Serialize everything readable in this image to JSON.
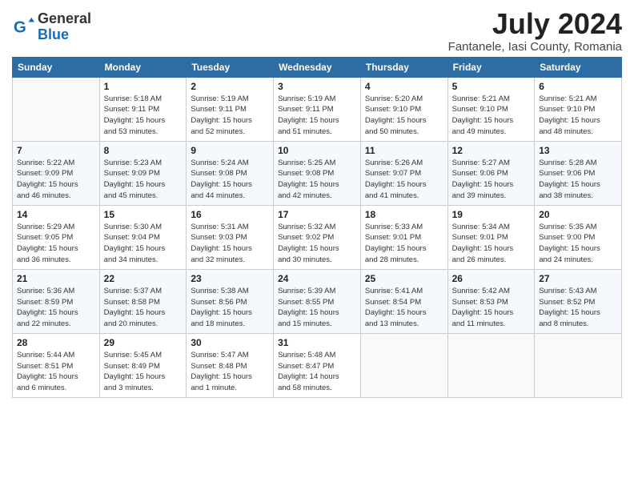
{
  "logo": {
    "general": "General",
    "blue": "Blue"
  },
  "title": "July 2024",
  "location": "Fantanele, Iasi County, Romania",
  "weekdays": [
    "Sunday",
    "Monday",
    "Tuesday",
    "Wednesday",
    "Thursday",
    "Friday",
    "Saturday"
  ],
  "weeks": [
    [
      {
        "day": "",
        "info": ""
      },
      {
        "day": "1",
        "info": "Sunrise: 5:18 AM\nSunset: 9:11 PM\nDaylight: 15 hours\nand 53 minutes."
      },
      {
        "day": "2",
        "info": "Sunrise: 5:19 AM\nSunset: 9:11 PM\nDaylight: 15 hours\nand 52 minutes."
      },
      {
        "day": "3",
        "info": "Sunrise: 5:19 AM\nSunset: 9:11 PM\nDaylight: 15 hours\nand 51 minutes."
      },
      {
        "day": "4",
        "info": "Sunrise: 5:20 AM\nSunset: 9:10 PM\nDaylight: 15 hours\nand 50 minutes."
      },
      {
        "day": "5",
        "info": "Sunrise: 5:21 AM\nSunset: 9:10 PM\nDaylight: 15 hours\nand 49 minutes."
      },
      {
        "day": "6",
        "info": "Sunrise: 5:21 AM\nSunset: 9:10 PM\nDaylight: 15 hours\nand 48 minutes."
      }
    ],
    [
      {
        "day": "7",
        "info": "Sunrise: 5:22 AM\nSunset: 9:09 PM\nDaylight: 15 hours\nand 46 minutes."
      },
      {
        "day": "8",
        "info": "Sunrise: 5:23 AM\nSunset: 9:09 PM\nDaylight: 15 hours\nand 45 minutes."
      },
      {
        "day": "9",
        "info": "Sunrise: 5:24 AM\nSunset: 9:08 PM\nDaylight: 15 hours\nand 44 minutes."
      },
      {
        "day": "10",
        "info": "Sunrise: 5:25 AM\nSunset: 9:08 PM\nDaylight: 15 hours\nand 42 minutes."
      },
      {
        "day": "11",
        "info": "Sunrise: 5:26 AM\nSunset: 9:07 PM\nDaylight: 15 hours\nand 41 minutes."
      },
      {
        "day": "12",
        "info": "Sunrise: 5:27 AM\nSunset: 9:06 PM\nDaylight: 15 hours\nand 39 minutes."
      },
      {
        "day": "13",
        "info": "Sunrise: 5:28 AM\nSunset: 9:06 PM\nDaylight: 15 hours\nand 38 minutes."
      }
    ],
    [
      {
        "day": "14",
        "info": "Sunrise: 5:29 AM\nSunset: 9:05 PM\nDaylight: 15 hours\nand 36 minutes."
      },
      {
        "day": "15",
        "info": "Sunrise: 5:30 AM\nSunset: 9:04 PM\nDaylight: 15 hours\nand 34 minutes."
      },
      {
        "day": "16",
        "info": "Sunrise: 5:31 AM\nSunset: 9:03 PM\nDaylight: 15 hours\nand 32 minutes."
      },
      {
        "day": "17",
        "info": "Sunrise: 5:32 AM\nSunset: 9:02 PM\nDaylight: 15 hours\nand 30 minutes."
      },
      {
        "day": "18",
        "info": "Sunrise: 5:33 AM\nSunset: 9:01 PM\nDaylight: 15 hours\nand 28 minutes."
      },
      {
        "day": "19",
        "info": "Sunrise: 5:34 AM\nSunset: 9:01 PM\nDaylight: 15 hours\nand 26 minutes."
      },
      {
        "day": "20",
        "info": "Sunrise: 5:35 AM\nSunset: 9:00 PM\nDaylight: 15 hours\nand 24 minutes."
      }
    ],
    [
      {
        "day": "21",
        "info": "Sunrise: 5:36 AM\nSunset: 8:59 PM\nDaylight: 15 hours\nand 22 minutes."
      },
      {
        "day": "22",
        "info": "Sunrise: 5:37 AM\nSunset: 8:58 PM\nDaylight: 15 hours\nand 20 minutes."
      },
      {
        "day": "23",
        "info": "Sunrise: 5:38 AM\nSunset: 8:56 PM\nDaylight: 15 hours\nand 18 minutes."
      },
      {
        "day": "24",
        "info": "Sunrise: 5:39 AM\nSunset: 8:55 PM\nDaylight: 15 hours\nand 15 minutes."
      },
      {
        "day": "25",
        "info": "Sunrise: 5:41 AM\nSunset: 8:54 PM\nDaylight: 15 hours\nand 13 minutes."
      },
      {
        "day": "26",
        "info": "Sunrise: 5:42 AM\nSunset: 8:53 PM\nDaylight: 15 hours\nand 11 minutes."
      },
      {
        "day": "27",
        "info": "Sunrise: 5:43 AM\nSunset: 8:52 PM\nDaylight: 15 hours\nand 8 minutes."
      }
    ],
    [
      {
        "day": "28",
        "info": "Sunrise: 5:44 AM\nSunset: 8:51 PM\nDaylight: 15 hours\nand 6 minutes."
      },
      {
        "day": "29",
        "info": "Sunrise: 5:45 AM\nSunset: 8:49 PM\nDaylight: 15 hours\nand 3 minutes."
      },
      {
        "day": "30",
        "info": "Sunrise: 5:47 AM\nSunset: 8:48 PM\nDaylight: 15 hours\nand 1 minute."
      },
      {
        "day": "31",
        "info": "Sunrise: 5:48 AM\nSunset: 8:47 PM\nDaylight: 14 hours\nand 58 minutes."
      },
      {
        "day": "",
        "info": ""
      },
      {
        "day": "",
        "info": ""
      },
      {
        "day": "",
        "info": ""
      }
    ]
  ]
}
